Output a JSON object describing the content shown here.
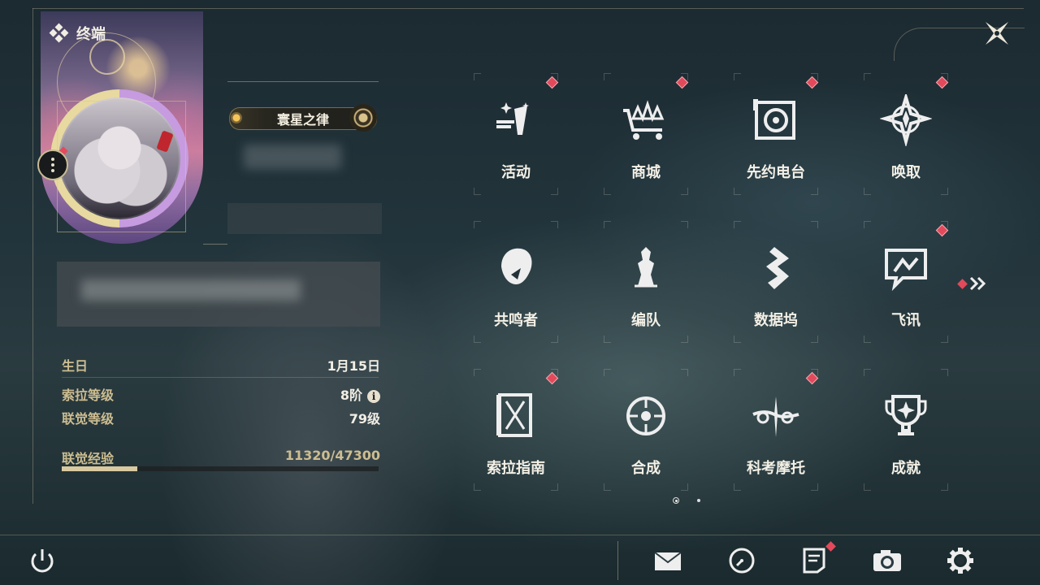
{
  "header": {
    "title": "终端"
  },
  "profile": {
    "title_badge": "寰星之律",
    "has_alert": true
  },
  "stats": {
    "birthday": {
      "label": "生日",
      "value": "1月15日"
    },
    "sora_level": {
      "label": "索拉等级",
      "value": "8阶",
      "info_icon": "info-icon"
    },
    "union_level": {
      "label": "联觉等级",
      "value": "79级"
    },
    "union_exp": {
      "label": "联觉经验",
      "value": "11320/47300",
      "progress": 0.239
    }
  },
  "grid": [
    {
      "label": "活动",
      "icon": "activity-icon",
      "badge": true
    },
    {
      "label": "商城",
      "icon": "shop-cart-icon",
      "badge": true
    },
    {
      "label": "先约电台",
      "icon": "radio-icon",
      "badge": true
    },
    {
      "label": "唤取",
      "icon": "convene-icon",
      "badge": true
    },
    {
      "label": "共鸣者",
      "icon": "resonator-icon",
      "badge": false
    },
    {
      "label": "编队",
      "icon": "team-chess-icon",
      "badge": false
    },
    {
      "label": "数据坞",
      "icon": "data-bank-icon",
      "badge": false
    },
    {
      "label": "飞讯",
      "icon": "message-icon",
      "badge": true
    },
    {
      "label": "索拉指南",
      "icon": "guide-icon",
      "badge": true
    },
    {
      "label": "合成",
      "icon": "synthesis-icon",
      "badge": false
    },
    {
      "label": "科考摩托",
      "icon": "motorcycle-icon",
      "badge": true
    },
    {
      "label": "成就",
      "icon": "trophy-icon",
      "badge": false
    }
  ],
  "pager": {
    "current": 1,
    "total": 2
  },
  "bottom_bar": {
    "items": [
      "power-icon",
      "mail-icon",
      "clock-icon",
      "notes-icon",
      "camera-icon",
      "settings-gear-icon"
    ],
    "notes_badge": true
  },
  "colors": {
    "accent": "#cdbd90",
    "alert": "#e24a5b",
    "text": "#f4f0e6"
  }
}
